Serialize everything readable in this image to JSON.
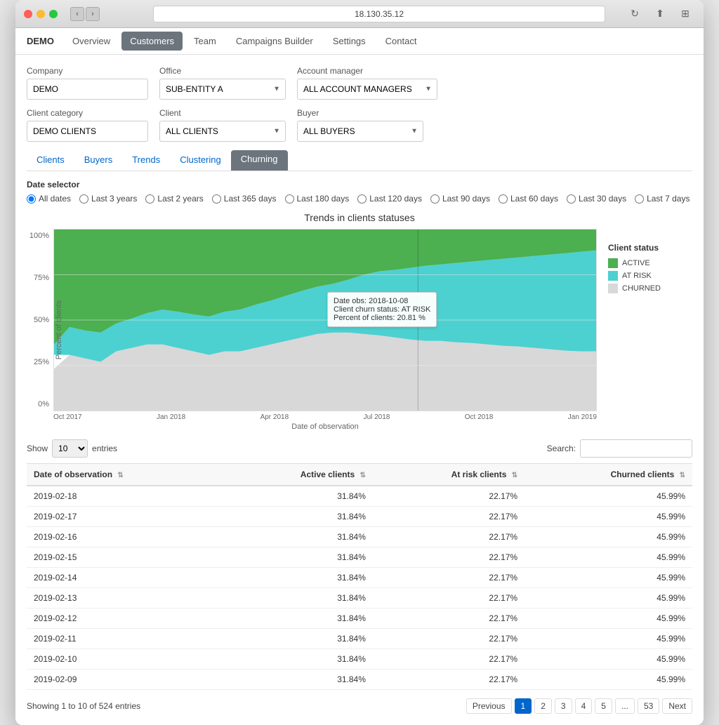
{
  "window": {
    "title": "18.130.35.12"
  },
  "navbar": {
    "brand": "DEMO",
    "items": [
      "Overview",
      "Customers",
      "Team",
      "Campaigns Builder",
      "Settings",
      "Contact"
    ],
    "active": "Customers"
  },
  "filters": {
    "company_label": "Company",
    "company_value": "DEMO",
    "office_label": "Office",
    "office_value": "SUB-ENTITY A",
    "account_manager_label": "Account manager",
    "account_manager_value": "ALL ACCOUNT MANAGERS",
    "client_category_label": "Client category",
    "client_category_value": "DEMO CLIENTS",
    "client_label": "Client",
    "client_value": "ALL CLIENTS",
    "buyer_label": "Buyer",
    "buyer_value": "ALL BUYERS"
  },
  "tabs": [
    "Clients",
    "Buyers",
    "Trends",
    "Clustering",
    "Churning"
  ],
  "active_tab": "Churning",
  "date_selector": {
    "label": "Date selector",
    "options": [
      "All dates",
      "Last 3 years",
      "Last 2 years",
      "Last 365 days",
      "Last 180 days",
      "Last 120 days",
      "Last 90 days",
      "Last 60 days",
      "Last 30 days",
      "Last 7 days"
    ],
    "selected": "All dates"
  },
  "chart": {
    "title": "Trends in clients statuses",
    "y_axis_label": "Percent of clients",
    "x_axis_label": "Date of observation",
    "y_ticks": [
      "100%",
      "75%",
      "50%",
      "25%",
      "0%"
    ],
    "x_ticks": [
      "Oct 2017",
      "Jan 2018",
      "Apr 2018",
      "Jul 2018",
      "Oct 2018",
      "Jan 2019"
    ],
    "legend_title": "Client status",
    "legend": [
      {
        "label": "ACTIVE",
        "color": "#4CAF50"
      },
      {
        "label": "AT RISK",
        "color": "#4dd0d0"
      },
      {
        "label": "CHURNED",
        "color": "#d8d8d8"
      }
    ],
    "tooltip": {
      "date_obs": "Date obs: 2018-10-08",
      "churn_status": "Client churn status: AT RISK",
      "percent": "Percent of clients: 20.81 %"
    }
  },
  "table": {
    "show_label": "Show",
    "entries_value": "10",
    "entries_label": "entries",
    "search_label": "Search:",
    "columns": [
      "Date of observation",
      "Active clients",
      "At risk clients",
      "Churned clients"
    ],
    "rows": [
      {
        "date": "2019-02-18",
        "active": "31.84%",
        "at_risk": "22.17%",
        "churned": "45.99%"
      },
      {
        "date": "2019-02-17",
        "active": "31.84%",
        "at_risk": "22.17%",
        "churned": "45.99%"
      },
      {
        "date": "2019-02-16",
        "active": "31.84%",
        "at_risk": "22.17%",
        "churned": "45.99%"
      },
      {
        "date": "2019-02-15",
        "active": "31.84%",
        "at_risk": "22.17%",
        "churned": "45.99%"
      },
      {
        "date": "2019-02-14",
        "active": "31.84%",
        "at_risk": "22.17%",
        "churned": "45.99%"
      },
      {
        "date": "2019-02-13",
        "active": "31.84%",
        "at_risk": "22.17%",
        "churned": "45.99%"
      },
      {
        "date": "2019-02-12",
        "active": "31.84%",
        "at_risk": "22.17%",
        "churned": "45.99%"
      },
      {
        "date": "2019-02-11",
        "active": "31.84%",
        "at_risk": "22.17%",
        "churned": "45.99%"
      },
      {
        "date": "2019-02-10",
        "active": "31.84%",
        "at_risk": "22.17%",
        "churned": "45.99%"
      },
      {
        "date": "2019-02-09",
        "active": "31.84%",
        "at_risk": "22.17%",
        "churned": "45.99%"
      }
    ],
    "footer": "Showing 1 to 10 of 524 entries",
    "pagination": {
      "previous": "Previous",
      "next": "Next",
      "pages": [
        "1",
        "2",
        "3",
        "4",
        "5",
        "...",
        "53"
      ]
    }
  }
}
